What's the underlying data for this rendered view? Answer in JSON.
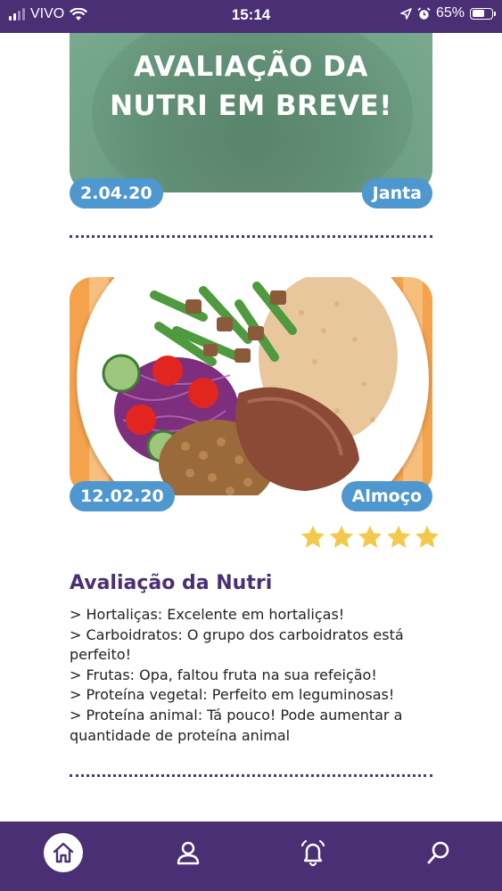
{
  "status_bar": {
    "carrier": "VIVO",
    "time": "15:14",
    "battery": "65%"
  },
  "cards": [
    {
      "overlay_text": "AVALIAÇÃO DA NUTRI EM BREVE!",
      "date": "2.04.20",
      "meal": "Janta"
    },
    {
      "date": "12.02.20",
      "meal": "Almoço",
      "rating": {
        "value": 5,
        "max": 5
      },
      "evaluation_title": "Avaliação da Nutri",
      "evaluation_items": [
        "> Hortaliças: Excelente em hortaliças!",
        "> Carboidratos: O grupo dos carboidratos está perfeito!",
        "> Frutas: Opa, faltou fruta na sua refeição!",
        "> Proteína vegetal: Perfeito em leguminosas!",
        "> Proteína animal: Tá pouco! Pode aumentar a quantidade de proteína animal"
      ]
    }
  ],
  "bottom_nav": [
    {
      "icon": "home-icon",
      "active": true
    },
    {
      "icon": "user-icon",
      "active": false
    },
    {
      "icon": "bell-icon",
      "active": false
    },
    {
      "icon": "search-icon",
      "active": false
    }
  ],
  "colors": {
    "primary": "#4a2f74",
    "pill": "#4f97cf",
    "star": "#f2c94c"
  }
}
